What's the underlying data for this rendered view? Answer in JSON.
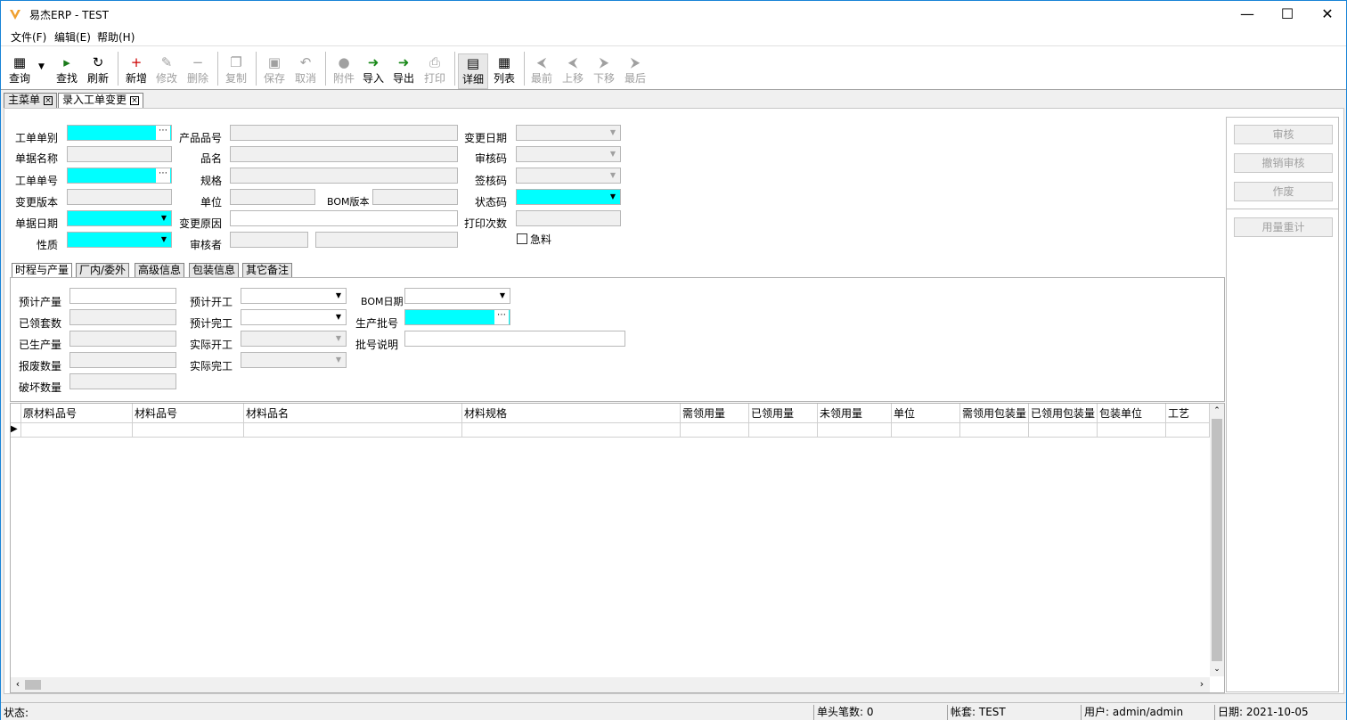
{
  "window": {
    "title": "易杰ERP - TEST"
  },
  "menu": [
    "文件(F)",
    "编辑(E)",
    "帮助(H)"
  ],
  "toolbar": {
    "query": "查询",
    "find": "查找",
    "refresh": "刷新",
    "add": "新增",
    "edit": "修改",
    "delete": "删除",
    "copy": "复制",
    "save": "保存",
    "cancel": "取消",
    "attach": "附件",
    "import": "导入",
    "export": "导出",
    "print": "打印",
    "detail": "详细",
    "list": "列表",
    "first": "最前",
    "prev": "上移",
    "next": "下移",
    "last": "最后"
  },
  "doc_tabs": [
    "主菜单",
    "录入工单变更"
  ],
  "header": {
    "wo_type": "工单单别",
    "doc_name": "单据名称",
    "wo_no": "工单单号",
    "change_ver": "变更版本",
    "doc_date": "单据日期",
    "nature": "性质",
    "product_no": "产品品号",
    "product_name": "品名",
    "spec": "规格",
    "unit": "单位",
    "bom_ver": "BOM版本",
    "change_reason": "变更原因",
    "reviewer": "审核者",
    "change_date": "变更日期",
    "audit_code": "审核码",
    "sign_code": "签核码",
    "status_code": "状态码",
    "print_count": "打印次数",
    "urgent": "急料"
  },
  "side_buttons": [
    "审核",
    "撤销审核",
    "作废",
    "用量重计"
  ],
  "sub_tabs": [
    "时程与产量",
    "厂内/委外",
    "高级信息",
    "包装信息",
    "其它备注"
  ],
  "schedule": {
    "plan_qty": "预计产量",
    "issued_sets": "已领套数",
    "produced_qty": "已生产量",
    "scrap_qty": "报废数量",
    "damaged_qty": "破坏数量",
    "plan_start": "预计开工",
    "plan_end": "预计完工",
    "actual_start": "实际开工",
    "actual_end": "实际完工",
    "bom_date": "BOM日期",
    "lot_no": "生产批号",
    "lot_desc": "批号说明"
  },
  "grid": {
    "columns": [
      "原材料品号",
      "材料品号",
      "材料品名",
      "材料规格",
      "需领用量",
      "已领用量",
      "未领用量",
      "单位",
      "需领用包装量",
      "已领用包装量",
      "包装单位",
      "工艺"
    ]
  },
  "status": {
    "label": "状态:",
    "header_count": "单头笔数: 0",
    "account": "帐套: TEST",
    "user": "用户: admin/admin",
    "date": "日期: 2021-10-05"
  }
}
